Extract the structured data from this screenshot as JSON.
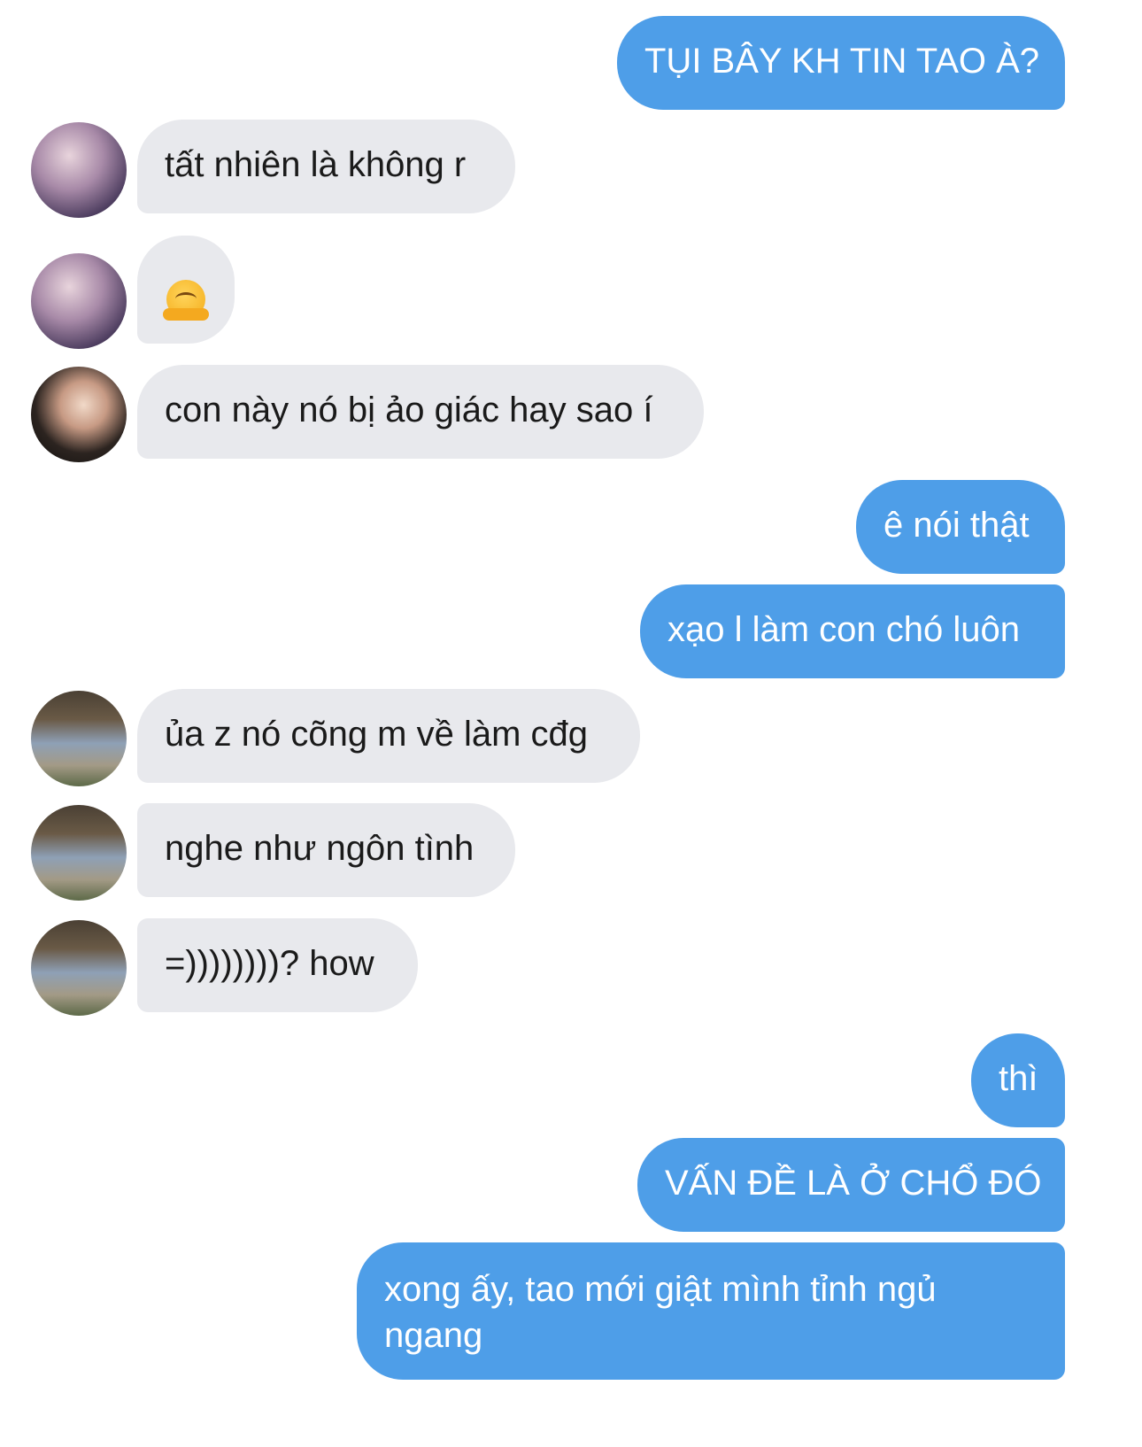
{
  "messages": [
    {
      "side": "out",
      "text": "TỤI BÂY KH TIN TAO À?"
    },
    {
      "side": "in",
      "avatar": "a",
      "text": "tất nhiên là không r"
    },
    {
      "side": "in",
      "avatar": "a",
      "emoji": "smiling-hug-emoji"
    },
    {
      "side": "in",
      "avatar": "b",
      "text": "con này nó bị ảo giác hay sao í"
    },
    {
      "side": "out",
      "text": "ê nói thật"
    },
    {
      "side": "out",
      "text": "xạo l làm con chó luôn"
    },
    {
      "side": "in",
      "avatar": "c",
      "text": "ủa z nó cõng m về làm cđg"
    },
    {
      "side": "in",
      "avatar": "c",
      "text": "nghe như ngôn tình"
    },
    {
      "side": "in",
      "avatar": "c",
      "text": "=))))))))? how"
    },
    {
      "side": "out",
      "text": "thì"
    },
    {
      "side": "out",
      "text": "VẤN ĐỀ LÀ Ở CHỔ ĐÓ"
    },
    {
      "side": "out",
      "text": "xong ấy, tao mới giật mình tỉnh ngủ ngang"
    }
  ],
  "colors": {
    "outgoing_bubble": "#4e9ee8",
    "incoming_bubble": "#e8e9ed",
    "background": "#ffffff"
  }
}
